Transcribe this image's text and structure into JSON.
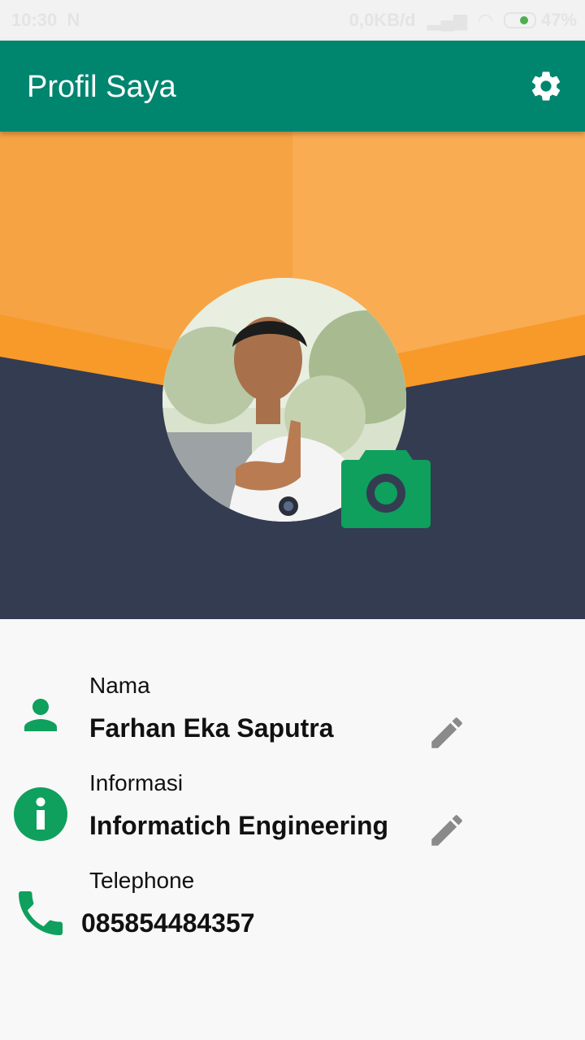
{
  "status_bar": {
    "time": "10:30",
    "network_speed": "0,0KB/d",
    "battery": "47%"
  },
  "app_bar": {
    "title": "Profil Saya",
    "settings_icon": "gear-icon"
  },
  "profile": {
    "photo": "profile-photo",
    "camera_icon": "camera-icon"
  },
  "fields": [
    {
      "label": "Nama",
      "value": "Farhan Eka Saputra",
      "icon": "person-icon",
      "editable": true
    },
    {
      "label": "Informasi",
      "value": "Informatich Engineering",
      "icon": "info-icon",
      "editable": true
    },
    {
      "label": "Telephone",
      "value": "085854484357",
      "icon": "phone-icon",
      "editable": false
    }
  ],
  "colors": {
    "app_bar": "#00856f",
    "header_orange": "#f6a64c",
    "header_dark": "#343c52",
    "accent_green": "#0ea05c",
    "edit_icon": "#8a8a8a"
  }
}
